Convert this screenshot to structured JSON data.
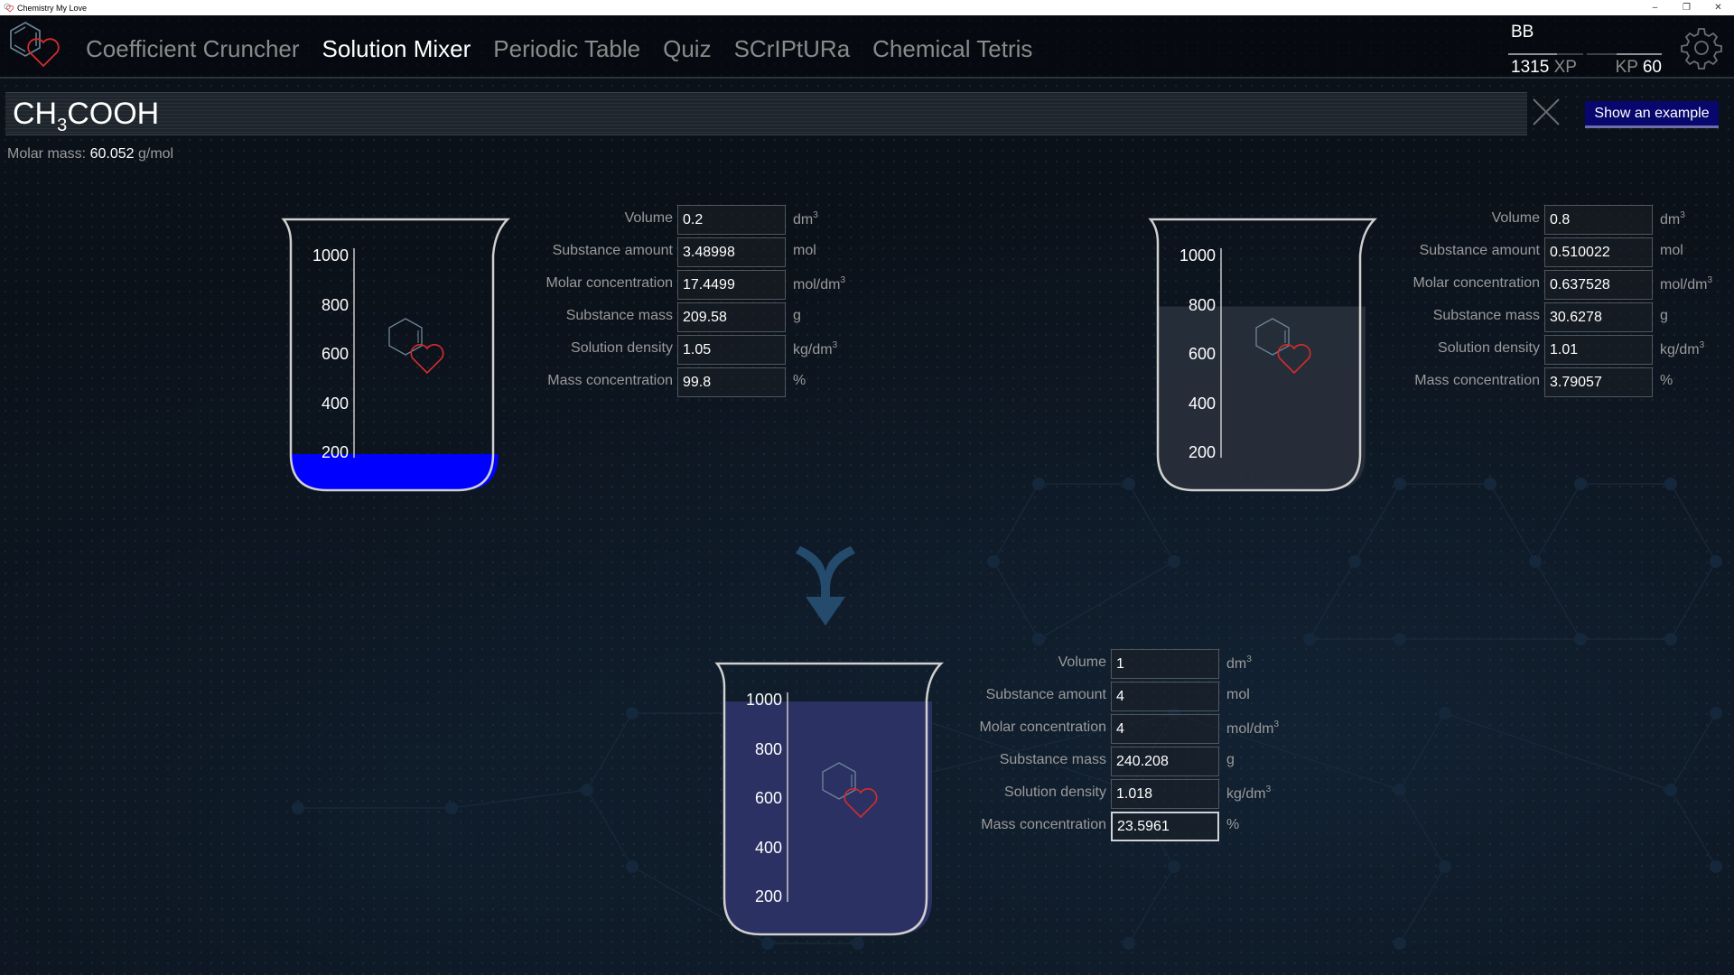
{
  "window": {
    "title": "Chemistry My Love",
    "controls": [
      "minimize",
      "restore",
      "close"
    ]
  },
  "nav": {
    "items": [
      {
        "label": "Coefficient Cruncher",
        "active": false
      },
      {
        "label": "Solution Mixer",
        "active": true
      },
      {
        "label": "Periodic Table",
        "active": false
      },
      {
        "label": "Quiz",
        "active": false
      },
      {
        "label": "SCrIPtURa",
        "active": false
      },
      {
        "label": "Chemical Tetris",
        "active": false
      }
    ]
  },
  "user": {
    "name": "BB",
    "xp_value": "1315",
    "xp_unit": "XP",
    "kp_unit": "KP",
    "kp_value": "60",
    "xp_progress": 0.65,
    "kp_progress": 0.6
  },
  "formula": {
    "prefix": "CH",
    "subscript": "3",
    "suffix": "COOH",
    "clear_icon": "close-icon",
    "example_button": "Show an example"
  },
  "molar_mass": {
    "label": "Molar mass:",
    "value": "60.052",
    "unit": "g/mol"
  },
  "beaker_scale": [
    "1000",
    "800",
    "600",
    "400",
    "200"
  ],
  "labels": {
    "volume": "Volume",
    "substance_amount": "Substance amount",
    "molar_concentration": "Molar concentration",
    "substance_mass": "Substance mass",
    "solution_density": "Solution density",
    "mass_concentration": "Mass concentration"
  },
  "units": {
    "volume": "dm",
    "volume_sup": "3",
    "substance_amount": "mol",
    "molar_concentration": "mol/dm",
    "molar_concentration_sup": "3",
    "substance_mass": "g",
    "solution_density": "kg/dm",
    "solution_density_sup": "3",
    "mass_concentration": "%"
  },
  "solutions": {
    "first": {
      "fill_ml": 200,
      "fill_color": "#0000ff",
      "volume": "0.2",
      "substance_amount": "3.48998",
      "molar_concentration": "17.4499",
      "substance_mass": "209.58",
      "solution_density": "1.05",
      "mass_concentration": "99.8"
    },
    "second": {
      "fill_ml": 800,
      "fill_color": "#2a313d",
      "volume": "0.8",
      "substance_amount": "0.510022",
      "molar_concentration": "0.637528",
      "substance_mass": "30.6278",
      "solution_density": "1.01",
      "mass_concentration": "3.79057"
    },
    "result": {
      "fill_ml": 1000,
      "fill_color": "#2c3163",
      "volume": "1",
      "substance_amount": "4",
      "molar_concentration": "4",
      "substance_mass": "240.208",
      "solution_density": "1.018",
      "mass_concentration": "23.5961"
    }
  }
}
